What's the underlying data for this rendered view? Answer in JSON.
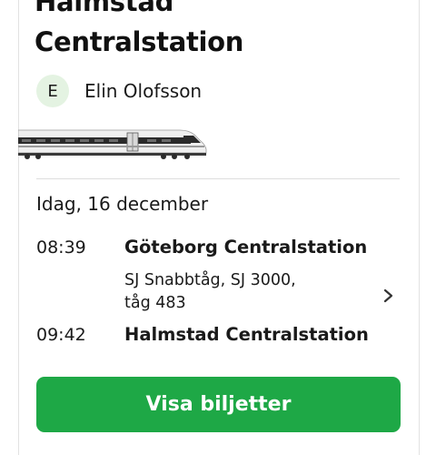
{
  "header": {
    "title_line1": "Halmstad",
    "title_line2": "Centralstation"
  },
  "passenger": {
    "initial": "E",
    "name": "Elin Olofsson"
  },
  "journey": {
    "date": "Idag, 16 december",
    "departure": {
      "time": "08:39",
      "station": "Göteborg Centralstation"
    },
    "service_line1": "SJ Snabbtåg, SJ 3000,",
    "service_line2": "tåg 483",
    "arrival": {
      "time": "09:42",
      "station": "Halmstad Centralstation"
    }
  },
  "actions": {
    "show_tickets_label": "Visa biljetter"
  },
  "colors": {
    "accent": "#1ea846",
    "avatar_bg": "#e4f3e2"
  },
  "icons": {
    "details": "chevron-right-icon",
    "train": "train-illustration"
  }
}
